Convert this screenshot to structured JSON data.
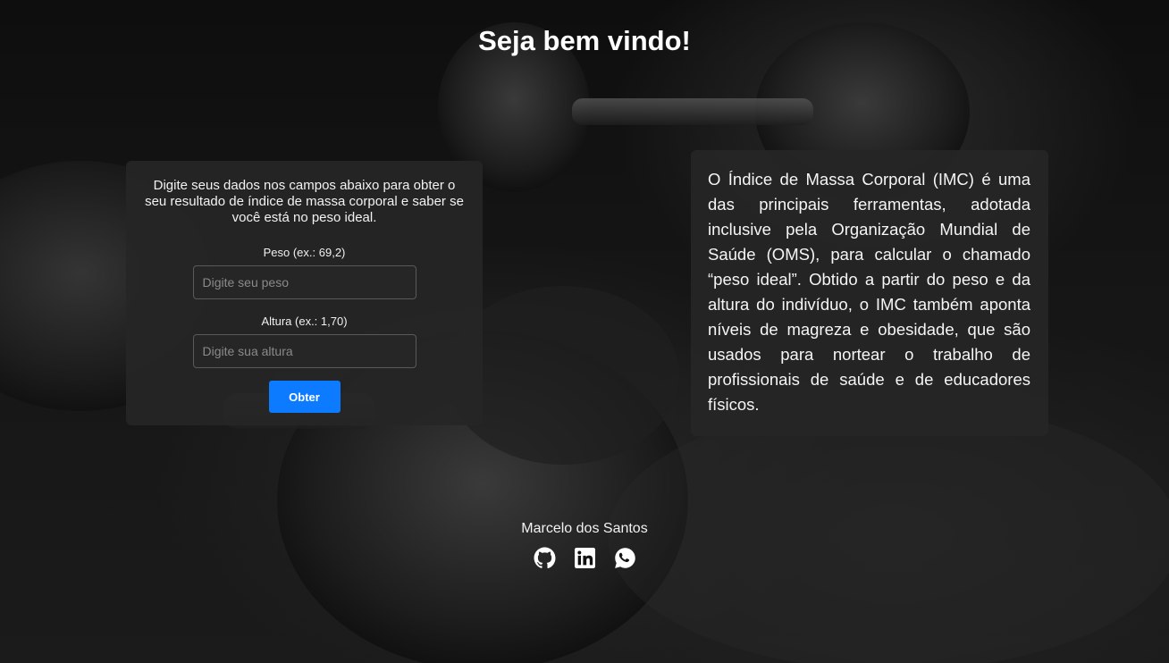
{
  "header": {
    "title": "Seja bem vindo!"
  },
  "form": {
    "intro": "Digite seus dados nos campos abaixo para obter o seu resultado de índice de massa corporal e saber se você está no peso ideal.",
    "weight_label": "Peso (ex.: 69,2)",
    "weight_placeholder": "Digite seu peso",
    "weight_value": "",
    "height_label": "Altura (ex.: 1,70)",
    "height_placeholder": "Digite sua altura",
    "height_value": "",
    "submit_label": "Obter",
    "submit_color": "#0d7bff"
  },
  "info": {
    "text": "O Índice de Massa Corporal (IMC) é uma das principais ferramentas, adotada inclusive pela Organização Mundial de Saúde (OMS), para calcular o chamado “peso ideal”. Obtido a partir do peso e da altura do indivíduo, o IMC também aponta níveis de magreza e obesidade, que são usados para nortear o trabalho de profissionais de saúde e de educadores físicos."
  },
  "footer": {
    "author": "Marcelo dos Santos",
    "social": [
      {
        "icon": "github-icon"
      },
      {
        "icon": "linkedin-icon"
      },
      {
        "icon": "whatsapp-icon"
      }
    ]
  },
  "background": {
    "subject": "dumbbells"
  }
}
